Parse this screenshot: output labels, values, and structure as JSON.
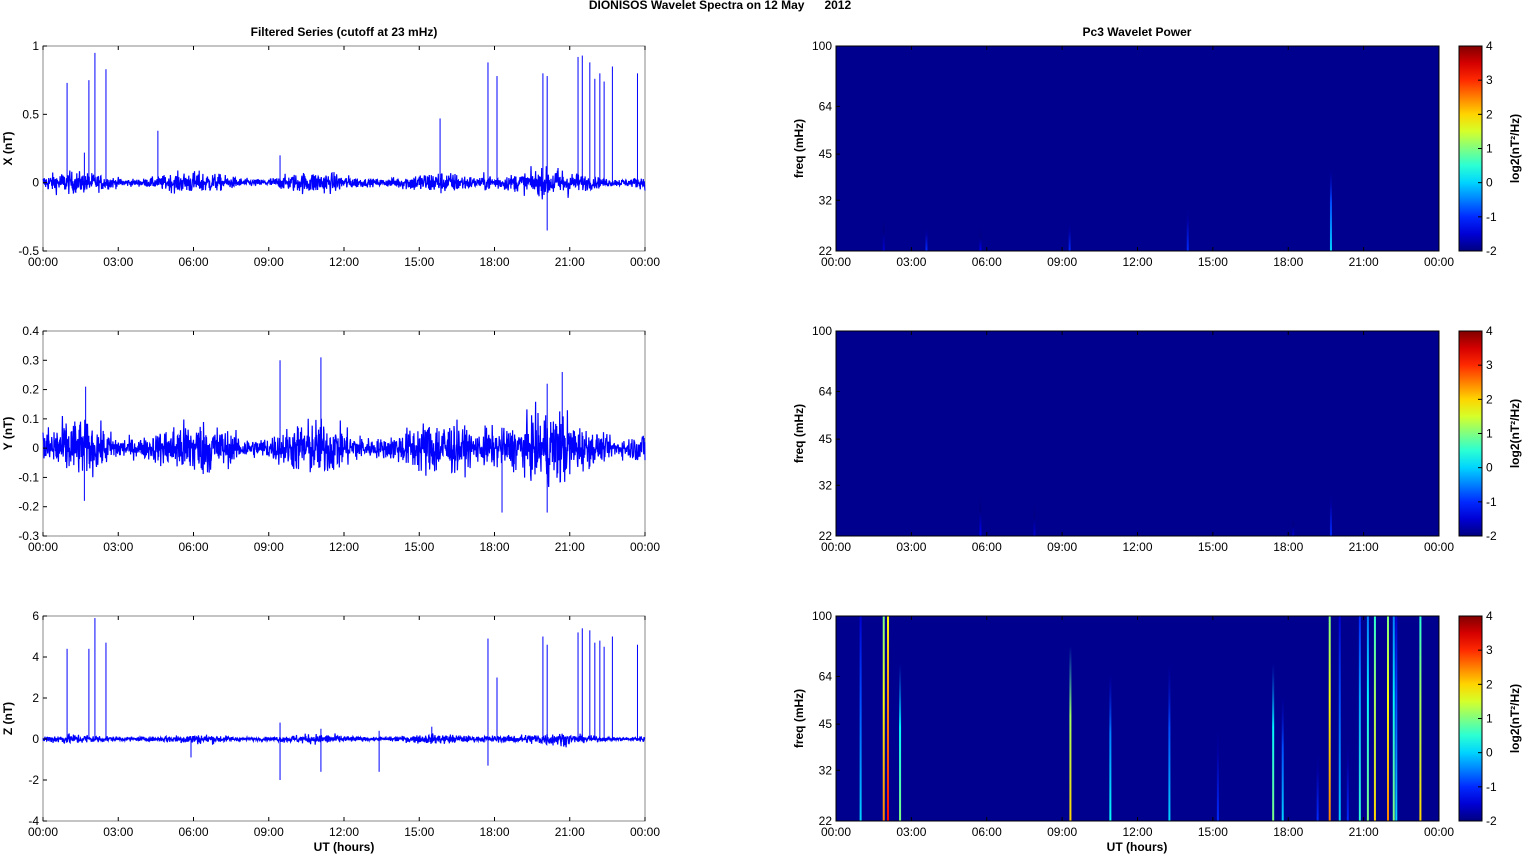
{
  "chart_data": {
    "title": "DIONISOS Wavelet Spectra on 12 May      2012",
    "left_title": "Filtered Series (cutoff at 23 mHz)",
    "right_title": "Pc3 Wavelet Power",
    "xlabel": "UT (hours)",
    "x_ticks": [
      "00:00",
      "03:00",
      "06:00",
      "09:00",
      "12:00",
      "15:00",
      "18:00",
      "21:00",
      "00:00"
    ],
    "xlim": [
      0,
      24
    ],
    "colors": {
      "line": "#0000ff",
      "background": "#00008f"
    },
    "series": [
      {
        "name": "X",
        "type": "line",
        "ylabel": "X (nT)",
        "ylim": [
          -0.5,
          1
        ],
        "y_ticks": [
          "-0.5",
          "0",
          "0.5",
          "1"
        ],
        "y_tick_values": [
          -0.5,
          0,
          0.5,
          1
        ],
        "noise_amplitude": 0.05,
        "spikes": [
          [
            0.96,
            0.73
          ],
          [
            1.65,
            0.22
          ],
          [
            1.83,
            0.75
          ],
          [
            2.07,
            0.95
          ],
          [
            2.51,
            0.83
          ],
          [
            4.58,
            0.38
          ],
          [
            9.45,
            0.2
          ],
          [
            15.83,
            0.47
          ],
          [
            17.74,
            0.88
          ],
          [
            18.1,
            0.78
          ],
          [
            19.93,
            0.8
          ],
          [
            20.1,
            0.78
          ],
          [
            20.1,
            -0.35
          ],
          [
            21.33,
            0.92
          ],
          [
            21.5,
            0.93
          ],
          [
            21.8,
            0.88
          ],
          [
            22.0,
            0.76
          ],
          [
            22.2,
            0.8
          ],
          [
            22.37,
            0.74
          ],
          [
            22.7,
            0.85
          ],
          [
            23.7,
            0.8
          ]
        ]
      },
      {
        "name": "Y",
        "type": "line",
        "ylabel": "Y (nT)",
        "ylim": [
          -0.3,
          0.4
        ],
        "y_ticks": [
          "-0.3",
          "-0.2",
          "-0.1",
          "0",
          "0.1",
          "0.2",
          "0.3",
          "0.4"
        ],
        "y_tick_values": [
          -0.3,
          -0.2,
          -0.1,
          0,
          0.1,
          0.2,
          0.3,
          0.4
        ],
        "noise_amplitude": 0.06,
        "spikes": [
          [
            1.65,
            -0.18
          ],
          [
            1.7,
            0.21
          ],
          [
            9.45,
            0.3
          ],
          [
            11.08,
            0.31
          ],
          [
            18.3,
            -0.22
          ],
          [
            20.1,
            0.22
          ],
          [
            20.1,
            -0.22
          ],
          [
            20.7,
            0.26
          ]
        ]
      },
      {
        "name": "Z",
        "type": "line",
        "ylabel": "Z (nT)",
        "ylim": [
          -4,
          6
        ],
        "y_ticks": [
          "-4",
          "-2",
          "0",
          "2",
          "4",
          "6"
        ],
        "y_tick_values": [
          -4,
          -2,
          0,
          2,
          4,
          6
        ],
        "noise_amplitude": 0.15,
        "spikes": [
          [
            0.96,
            4.4
          ],
          [
            1.83,
            4.4
          ],
          [
            2.07,
            5.9
          ],
          [
            2.51,
            4.7
          ],
          [
            5.9,
            -0.9
          ],
          [
            9.45,
            -2.0
          ],
          [
            9.45,
            0.8
          ],
          [
            11.08,
            -1.6
          ],
          [
            11.08,
            0.5
          ],
          [
            13.4,
            -1.6
          ],
          [
            13.4,
            0.4
          ],
          [
            15.5,
            0.6
          ],
          [
            17.74,
            4.9
          ],
          [
            17.74,
            -1.3
          ],
          [
            18.1,
            3.0
          ],
          [
            19.93,
            5.0
          ],
          [
            20.1,
            4.6
          ],
          [
            21.33,
            5.2
          ],
          [
            21.5,
            5.4
          ],
          [
            21.8,
            5.3
          ],
          [
            22.0,
            4.7
          ],
          [
            22.2,
            4.8
          ],
          [
            22.37,
            4.5
          ],
          [
            22.7,
            5.0
          ],
          [
            23.7,
            4.6
          ]
        ]
      }
    ],
    "spectrograms": [
      {
        "type": "heatmap",
        "ylabel": "freq (mHz)",
        "ylim": [
          22,
          100
        ],
        "y_ticks": [
          "22",
          "32",
          "45",
          "64",
          "100"
        ],
        "y_tick_values": [
          22,
          32,
          45,
          64,
          100
        ],
        "colorbar_label": "log2(nT²/Hz)",
        "clim": [
          -2,
          4
        ],
        "colorbar_ticks": [
          "-2",
          "-1",
          "0",
          "1",
          "2",
          "3",
          "4"
        ],
        "streaks": [
          [
            1.9,
            28,
            -1.5
          ],
          [
            3.6,
            27,
            -1
          ],
          [
            5.75,
            26,
            -1.3
          ],
          [
            9.3,
            28,
            -1
          ],
          [
            14.0,
            32,
            -1
          ],
          [
            19.7,
            40,
            0
          ]
        ]
      },
      {
        "type": "heatmap",
        "ylabel": "freq (mHz)",
        "ylim": [
          22,
          100
        ],
        "y_ticks": [
          "22",
          "32",
          "45",
          "64",
          "100"
        ],
        "y_tick_values": [
          22,
          32,
          45,
          64,
          100
        ],
        "colorbar_label": "log2(nT²/Hz)",
        "clim": [
          -2,
          4
        ],
        "colorbar_ticks": [
          "-2",
          "-1",
          "0",
          "1",
          "2",
          "3",
          "4"
        ],
        "streaks": [
          [
            5.75,
            30,
            -1.3
          ],
          [
            7.9,
            28,
            -1.5
          ],
          [
            18.2,
            25,
            -1.5
          ],
          [
            19.7,
            32,
            -1
          ]
        ]
      },
      {
        "type": "heatmap",
        "ylabel": "freq (mHz)",
        "ylim": [
          22,
          100
        ],
        "y_ticks": [
          "22",
          "32",
          "45",
          "64",
          "100"
        ],
        "y_tick_values": [
          22,
          32,
          45,
          64,
          100
        ],
        "colorbar_label": "log2(nT²/Hz)",
        "clim": [
          -2,
          4
        ],
        "colorbar_ticks": [
          "-2",
          "-1",
          "0",
          "1",
          "2",
          "3",
          "4"
        ],
        "streaks": [
          [
            0.98,
            100,
            0
          ],
          [
            1.9,
            100,
            2.5
          ],
          [
            2.07,
            100,
            3.2
          ],
          [
            2.55,
            70,
            1
          ],
          [
            9.33,
            80,
            2
          ],
          [
            10.92,
            65,
            0.3
          ],
          [
            13.27,
            70,
            0
          ],
          [
            15.2,
            50,
            -1
          ],
          [
            17.4,
            70,
            1
          ],
          [
            17.78,
            55,
            0
          ],
          [
            19.17,
            40,
            -1
          ],
          [
            19.65,
            100,
            2.5
          ],
          [
            20.05,
            100,
            0
          ],
          [
            20.37,
            45,
            -1
          ],
          [
            20.85,
            100,
            0.5
          ],
          [
            21.17,
            100,
            1
          ],
          [
            21.45,
            100,
            2
          ],
          [
            21.97,
            100,
            2.5
          ],
          [
            22.2,
            100,
            1
          ],
          [
            22.3,
            100,
            0
          ],
          [
            23.26,
            100,
            2
          ]
        ]
      }
    ]
  }
}
